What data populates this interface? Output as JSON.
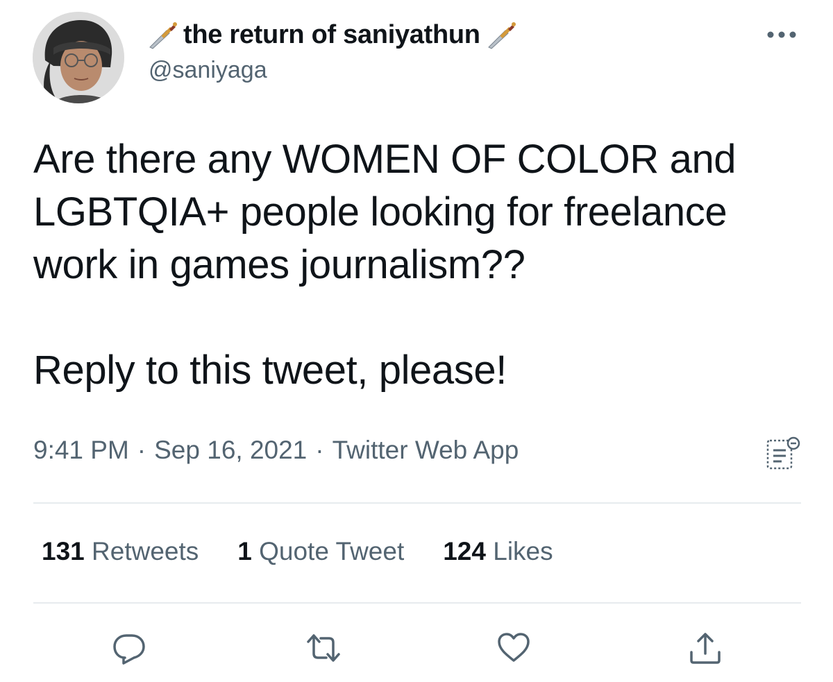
{
  "author": {
    "display_name": "the return of saniyathun",
    "handle": "@saniyaga",
    "name_prefix_icon": "dagger-icon",
    "name_suffix_icon": "dagger-icon",
    "avatar_icon": "avatar"
  },
  "tweet": {
    "paragraphs": [
      "Are there any WOMEN OF COLOR and LGBTQIA+ people looking for freelance work in games journalism??",
      "Reply to this tweet, please!"
    ],
    "time": "9:41 PM",
    "separator": "·",
    "date": "Sep 16, 2021",
    "source": "Twitter Web App"
  },
  "stats": {
    "retweets_count": "131",
    "retweets_label": "Retweets",
    "quotes_count": "1",
    "quotes_label": "Quote Tweet",
    "likes_count": "124",
    "likes_label": "Likes"
  },
  "icons": {
    "more": "more-options-icon",
    "analytics": "analytics-icon",
    "reply": "reply-icon",
    "retweet": "retweet-icon",
    "like": "like-icon",
    "share": "share-icon"
  },
  "colors": {
    "text_primary": "#0f1419",
    "text_secondary": "#536471",
    "divider": "#e7ebee"
  }
}
